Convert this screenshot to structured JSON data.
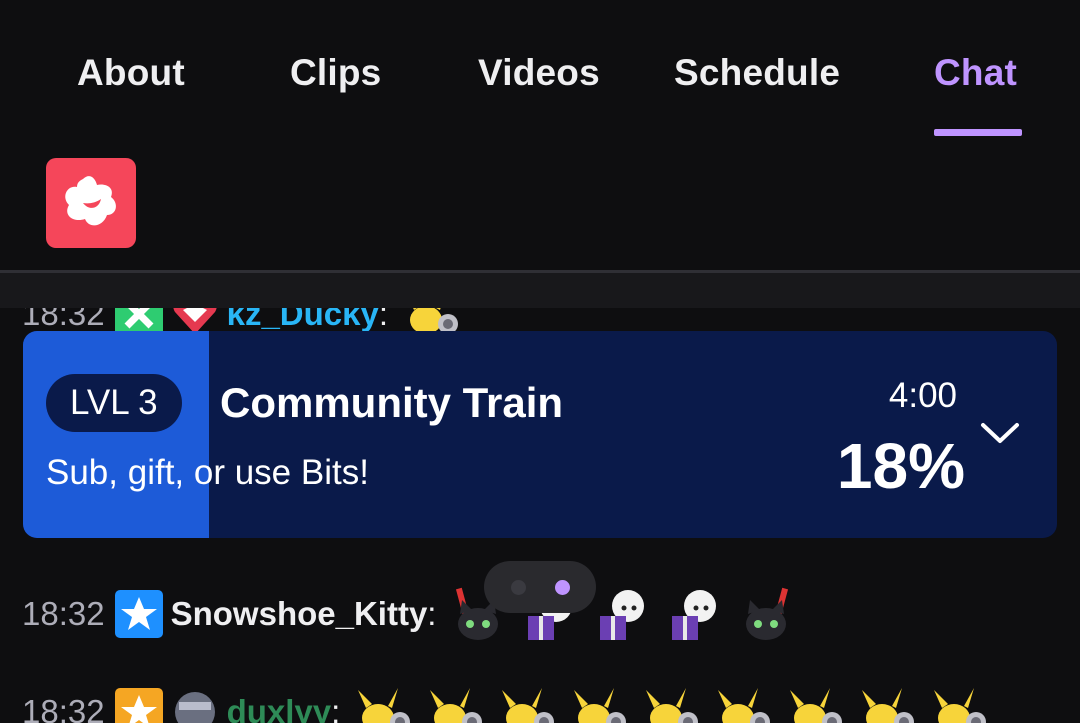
{
  "tabs": [
    {
      "label": "About"
    },
    {
      "label": "Clips"
    },
    {
      "label": "Videos"
    },
    {
      "label": "Schedule"
    },
    {
      "label": "Chat"
    }
  ],
  "active_tab": "Chat",
  "colors": {
    "accent": "#bf94ff",
    "background": "#0e0e10",
    "train_fill": "#1d5bd8",
    "train_bg": "#0a1a4a",
    "logo": "#f5465a"
  },
  "chat": {
    "messages": [
      {
        "time": "18:32",
        "username": "kz_Ducky",
        "color": "#29b6f6",
        "emotes": [
          "pikachu-emote"
        ]
      },
      {
        "time": "18:32",
        "username": "Snowshoe_Kitty",
        "color": "#efeff1",
        "emotes": [
          "cat-emote",
          "gift-emote",
          "gift-emote",
          "gift-emote",
          "cat-emote"
        ]
      },
      {
        "time": "18:32",
        "username": "duxlyy",
        "color": "#2e8b57",
        "emotes": [
          "pikachu-emote",
          "pikachu-emote",
          "pikachu-emote",
          "pikachu-emote",
          "pikachu-emote",
          "pikachu-emote",
          "pikachu-emote",
          "pikachu-emote",
          "pikachu-emote"
        ]
      }
    ]
  },
  "train": {
    "level": "LVL 3",
    "title": "Community Train",
    "subtitle": "Sub, gift, or use Bits!",
    "timer": "4:00",
    "percent_label": "18%",
    "progress": 0.18
  },
  "pager": {
    "pages": 2,
    "active_index": 1
  }
}
